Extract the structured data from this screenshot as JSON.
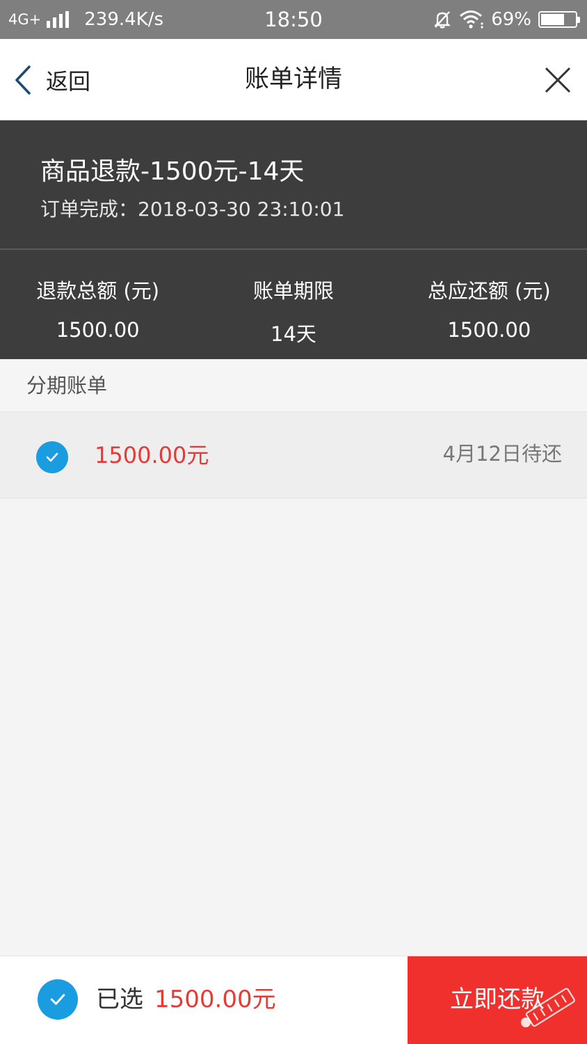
{
  "status_bar": {
    "network": "4G+",
    "speed": "239.4K/s",
    "time": "18:50",
    "battery_pct": "69%",
    "battery_level": 0.69
  },
  "nav": {
    "back_label": "返回",
    "title": "账单详情"
  },
  "order": {
    "title": "商品退款-1500元-14天",
    "completed": "订单完成：2018-03-30 23:10:01"
  },
  "summary": [
    {
      "label": "退款总额 (元)",
      "value": "1500.00"
    },
    {
      "label": "账单期限",
      "value": "14天"
    },
    {
      "label": "总应还额 (元)",
      "value": "1500.00"
    }
  ],
  "installments": {
    "header": "分期账单",
    "items": [
      {
        "amount": "1500.00元",
        "due": "4月12日待还",
        "checked": true
      }
    ]
  },
  "footer": {
    "selected_label": "已选",
    "selected_amount": "1500.00元",
    "pay_label": "立即还款"
  },
  "colors": {
    "accent_blue": "#1a9de0",
    "amount_red": "#e53a36",
    "pay_button": "#f0302d",
    "dark_header": "#3d3d3d"
  }
}
